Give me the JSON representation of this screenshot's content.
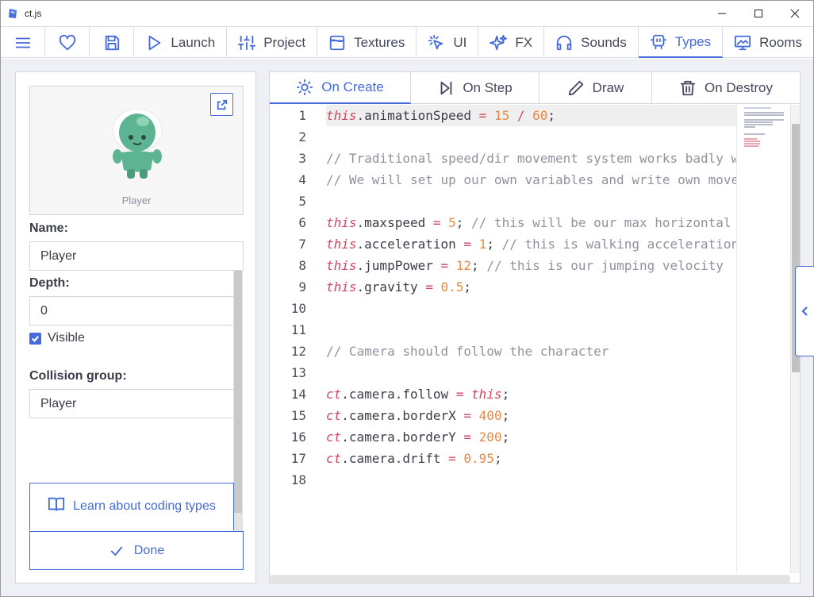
{
  "window": {
    "title": "ct.js"
  },
  "nav": {
    "items": [
      {
        "label": "",
        "icon": "menu-icon"
      },
      {
        "label": "",
        "icon": "heart-icon"
      },
      {
        "label": "",
        "icon": "save-icon"
      },
      {
        "label": "Launch",
        "icon": "play-icon"
      },
      {
        "label": "Project",
        "icon": "sliders-icon"
      },
      {
        "label": "Textures",
        "icon": "texture-icon"
      },
      {
        "label": "UI",
        "icon": "cursor-icon"
      },
      {
        "label": "FX",
        "icon": "sparkles-icon"
      },
      {
        "label": "Sounds",
        "icon": "headphones-icon"
      },
      {
        "label": "Types",
        "icon": "robot-icon"
      },
      {
        "label": "Rooms",
        "icon": "monitor-icon"
      }
    ],
    "active": "Types"
  },
  "type_panel": {
    "preview_name": "Player",
    "name_label": "Name:",
    "name_value": "Player",
    "depth_label": "Depth:",
    "depth_value": "0",
    "visible_label": "Visible",
    "visible_checked": true,
    "collision_label": "Collision group:",
    "collision_value": "Player",
    "learn_label": "Learn about coding types",
    "done_label": "Done"
  },
  "editor": {
    "tabs": [
      {
        "label": "On Create",
        "icon": "sun-icon"
      },
      {
        "label": "On Step",
        "icon": "step-forward-icon"
      },
      {
        "label": "Draw",
        "icon": "pencil-icon"
      },
      {
        "label": "On Destroy",
        "icon": "trash-icon"
      }
    ],
    "active_tab": "On Create",
    "line_numbers": [
      "1",
      "2",
      "3",
      "4",
      "5",
      "6",
      "7",
      "8",
      "9",
      "10",
      "11",
      "12",
      "13",
      "14",
      "15",
      "16",
      "17",
      "18"
    ]
  },
  "colors": {
    "accent": "#446adb",
    "keyword": "#d2455f",
    "number": "#e88a45",
    "comment": "#8f939e"
  }
}
